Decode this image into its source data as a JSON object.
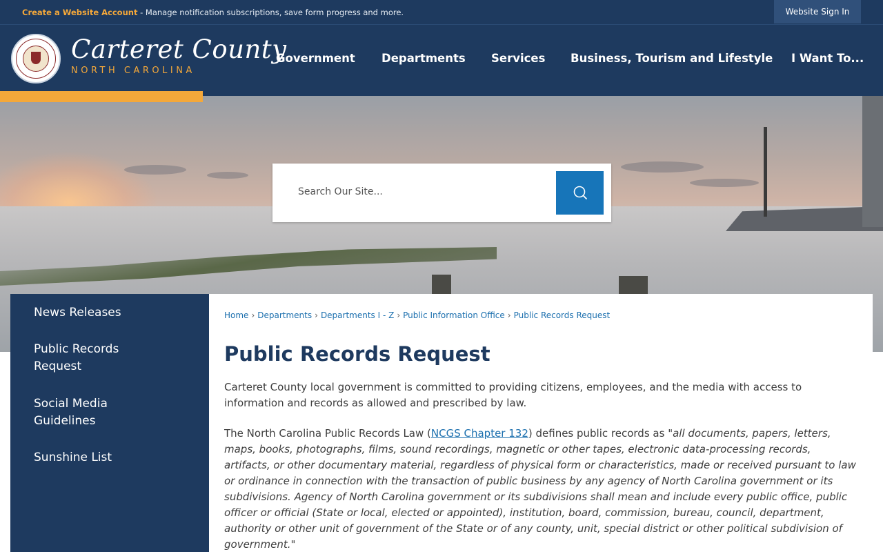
{
  "topbar": {
    "create_account_link": "Create a Website Account",
    "notice_text": " - Manage notification subscriptions, save form progress and more.",
    "sign_in_label": "Website Sign In"
  },
  "header": {
    "logo_title": "Carteret County",
    "logo_subtitle": "NORTH CAROLINA",
    "nav": [
      {
        "label": "Government"
      },
      {
        "label": "Departments"
      },
      {
        "label": "Services"
      },
      {
        "label": "Business, Tourism and Lifestyle"
      },
      {
        "label": "I Want To..."
      }
    ]
  },
  "search": {
    "placeholder": "Search Our Site...",
    "button_icon": "search-icon"
  },
  "sidebar": {
    "items": [
      {
        "label": "News Releases"
      },
      {
        "label": "Public Records Request"
      },
      {
        "label": "Social Media Guidelines"
      },
      {
        "label": "Sunshine List"
      }
    ]
  },
  "breadcrumb": [
    "Home",
    "Departments",
    "Departments I - Z",
    "Public Information Office",
    "Public Records Request"
  ],
  "main": {
    "title": "Public Records Request",
    "para1": "Carteret County local government is committed to providing citizens, employees, and the media with access to information and records as allowed and prescribed by law.",
    "para2_prefix": "The North Carolina Public Records Law (",
    "para2_link": "NCGS Chapter 132",
    "para2_mid": ") defines public records as ",
    "para2_quote": "\"all documents, papers, letters, maps, books, photographs, films, sound recordings, magnetic or other tapes, electronic data-processing records, artifacts, or other documentary material, regardless of physical form or characteristics, made or received pursuant to law or ordinance in connection with the transaction of public business by any agency of North Carolina government or its subdivisions. Agency of North Carolina government or its subdivisions shall mean and include every public office, public officer or official (State or local, elected or appointed), institution, board, commission, bureau, council, department, authority or other unit of government of the State or of any county, unit, special district or other political subdivision of government.\""
  },
  "colors": {
    "navy": "#1e3a5f",
    "accent_orange": "#f4a83a",
    "link_blue": "#1b6fae",
    "search_button": "#1775b9"
  }
}
